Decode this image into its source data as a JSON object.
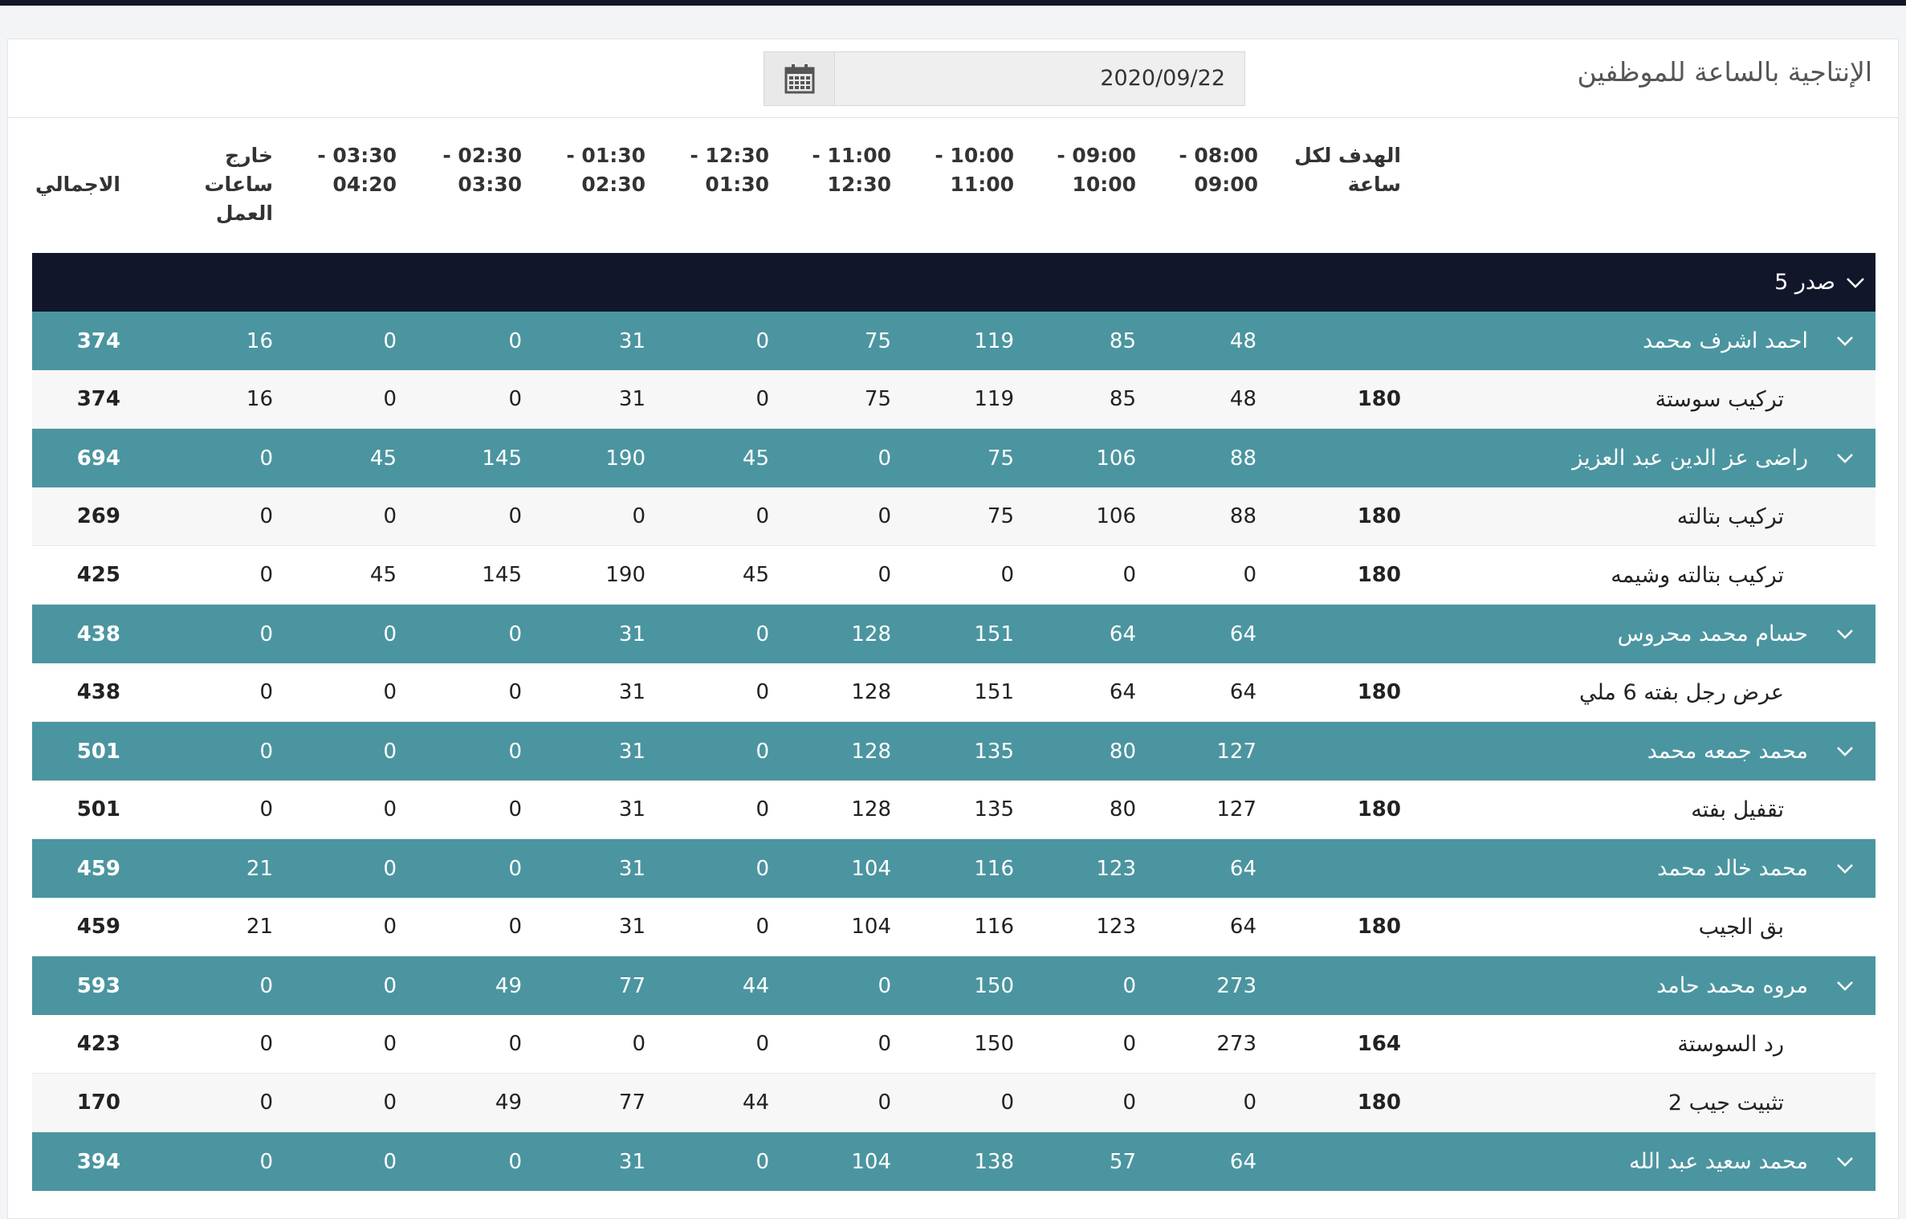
{
  "page": {
    "title": "الإنتاجية بالساعة للموظفين",
    "date_value": "2020/09/22"
  },
  "icons": {
    "calendar": "calendar-icon",
    "chevron": "chevron-down-icon"
  },
  "colors": {
    "section_bg": "#12162b",
    "group_bg": "#4b95a0",
    "top_bar": "#141727"
  },
  "table": {
    "headers": {
      "target": "الهدف لكل\nساعة",
      "h0800": "08:00 -\n09:00",
      "h0900": "09:00 -\n10:00",
      "h1000": "10:00 -\n11:00",
      "h1100": "11:00 -\n12:30",
      "h1230": "12:30 -\n01:30",
      "h0130": "01:30 -\n02:30",
      "h0230": "02:30 -\n03:30",
      "h0330": "03:30 -\n04:20",
      "outside": "خارج ساعات\nالعمل",
      "total": "الاجمالي"
    },
    "section": {
      "label": "صدر 5"
    },
    "rows": [
      {
        "type": "group",
        "name": "احمد اشرف محمد",
        "target": "",
        "v": [
          "48",
          "85",
          "119",
          "75",
          "0",
          "31",
          "0",
          "0",
          "16"
        ],
        "total": "374"
      },
      {
        "type": "detail",
        "alt": true,
        "name": "تركيب سوستة",
        "target": "180",
        "v": [
          "48",
          "85",
          "119",
          "75",
          "0",
          "31",
          "0",
          "0",
          "16"
        ],
        "total": "374"
      },
      {
        "type": "group",
        "name": "راضى عز الدين عبد العزيز",
        "target": "",
        "v": [
          "88",
          "106",
          "75",
          "0",
          "45",
          "190",
          "145",
          "45",
          "0"
        ],
        "total": "694"
      },
      {
        "type": "detail",
        "alt": true,
        "name": "تركيب بتالته",
        "target": "180",
        "v": [
          "88",
          "106",
          "75",
          "0",
          "0",
          "0",
          "0",
          "0",
          "0"
        ],
        "total": "269"
      },
      {
        "type": "detail",
        "alt": false,
        "name": "تركيب بتالته وشيمه",
        "target": "180",
        "v": [
          "0",
          "0",
          "0",
          "0",
          "45",
          "190",
          "145",
          "45",
          "0"
        ],
        "total": "425"
      },
      {
        "type": "group",
        "name": "حسام محمد محروس",
        "target": "",
        "v": [
          "64",
          "64",
          "151",
          "128",
          "0",
          "31",
          "0",
          "0",
          "0"
        ],
        "total": "438"
      },
      {
        "type": "detail",
        "alt": false,
        "name": "عرض رجل بفته 6 ملي",
        "target": "180",
        "v": [
          "64",
          "64",
          "151",
          "128",
          "0",
          "31",
          "0",
          "0",
          "0"
        ],
        "total": "438"
      },
      {
        "type": "group",
        "name": "محمد جمعه محمد",
        "target": "",
        "v": [
          "127",
          "80",
          "135",
          "128",
          "0",
          "31",
          "0",
          "0",
          "0"
        ],
        "total": "501"
      },
      {
        "type": "detail",
        "alt": false,
        "name": "تقفيل بفته",
        "target": "180",
        "v": [
          "127",
          "80",
          "135",
          "128",
          "0",
          "31",
          "0",
          "0",
          "0"
        ],
        "total": "501"
      },
      {
        "type": "group",
        "name": "محمد خالد محمد",
        "target": "",
        "v": [
          "64",
          "123",
          "116",
          "104",
          "0",
          "31",
          "0",
          "0",
          "21"
        ],
        "total": "459"
      },
      {
        "type": "detail",
        "alt": false,
        "name": "بق الجيب",
        "target": "180",
        "v": [
          "64",
          "123",
          "116",
          "104",
          "0",
          "31",
          "0",
          "0",
          "21"
        ],
        "total": "459"
      },
      {
        "type": "group",
        "name": "مروه محمد حامد",
        "target": "",
        "v": [
          "273",
          "0",
          "150",
          "0",
          "44",
          "77",
          "49",
          "0",
          "0"
        ],
        "total": "593"
      },
      {
        "type": "detail",
        "alt": false,
        "name": "رد السوستة",
        "target": "164",
        "v": [
          "273",
          "0",
          "150",
          "0",
          "0",
          "0",
          "0",
          "0",
          "0"
        ],
        "total": "423"
      },
      {
        "type": "detail",
        "alt": true,
        "name": "تثبيت جيب 2",
        "target": "180",
        "v": [
          "0",
          "0",
          "0",
          "0",
          "44",
          "77",
          "49",
          "0",
          "0"
        ],
        "total": "170"
      },
      {
        "type": "group",
        "name": "محمد سعيد عبد الله",
        "target": "",
        "v": [
          "64",
          "57",
          "138",
          "104",
          "0",
          "31",
          "0",
          "0",
          "0"
        ],
        "total": "394"
      }
    ]
  }
}
